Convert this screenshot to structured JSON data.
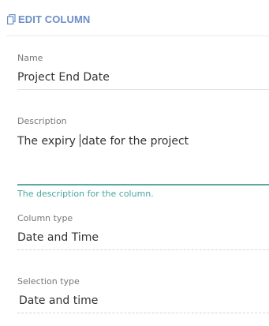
{
  "header": {
    "title": "EDIT COLUMN",
    "icon": "copy-icon",
    "accent_color": "#6b8fc7"
  },
  "fields": {
    "name": {
      "label": "Name",
      "value": "Project End Date"
    },
    "description": {
      "label": "Description",
      "value_before_caret": "The expiry ",
      "value_after_caret": "date for the project",
      "helper": "The description for the column.",
      "focus_color": "#5aa9a5"
    },
    "column_type": {
      "label": "Column type",
      "value": "Date and Time"
    },
    "selection_type": {
      "label": "Selection type",
      "value": "Date and time"
    }
  }
}
